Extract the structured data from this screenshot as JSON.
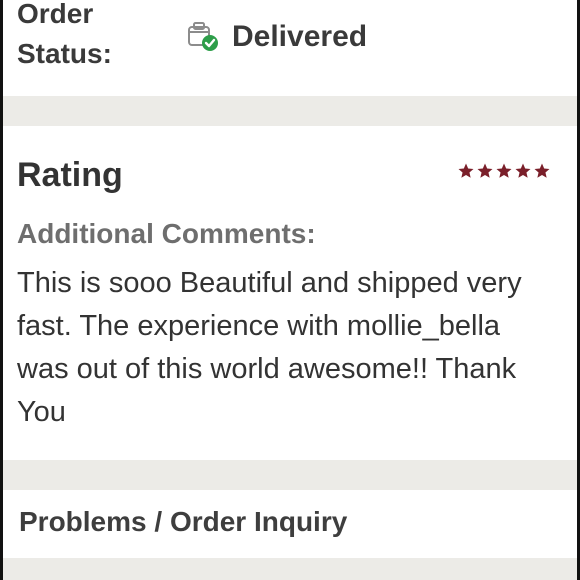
{
  "order_status": {
    "label": "Order Status:",
    "value": "Delivered",
    "icon": "delivered-check-icon"
  },
  "rating": {
    "title": "Rating",
    "stars": 5,
    "max_stars": 5,
    "star_color": "#7a1f2a",
    "comments_label": "Additional Comments:",
    "comments_text": "This is sooo Beautiful and shipped very fast. The experience with mollie_bella was out of this world awesome!! Thank You"
  },
  "problems": {
    "title": "Problems / Order Inquiry"
  },
  "colors": {
    "card": "#ffffff",
    "background": "#ecebe7",
    "accent_green": "#2e9e4a",
    "star_red": "#7a1f2a"
  }
}
